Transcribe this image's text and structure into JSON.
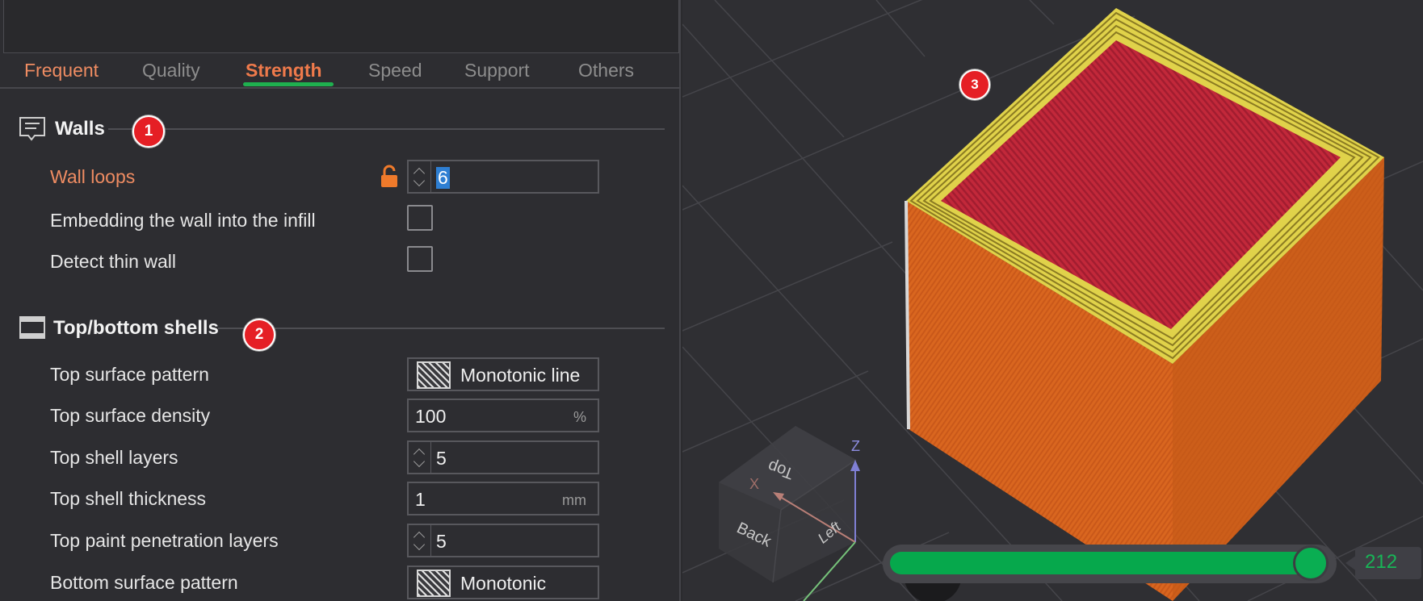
{
  "tabs": [
    {
      "label": "Frequent"
    },
    {
      "label": "Quality"
    },
    {
      "label": "Strength"
    },
    {
      "label": "Speed"
    },
    {
      "label": "Support"
    },
    {
      "label": "Others"
    }
  ],
  "active_tab": "Strength",
  "sections": {
    "walls": {
      "title": "Walls",
      "badge": "1",
      "rows": {
        "wall_loops": {
          "label": "Wall loops",
          "value": "6"
        },
        "embed_wall": {
          "label": "Embedding the wall into the infill",
          "checked": false
        },
        "detect_thin_wall": {
          "label": "Detect thin wall",
          "checked": false
        }
      }
    },
    "shells": {
      "title": "Top/bottom shells",
      "badge": "2",
      "rows": {
        "top_surface_pattern": {
          "label": "Top surface pattern",
          "value": "Monotonic line"
        },
        "top_surface_density": {
          "label": "Top surface density",
          "value": "100",
          "unit": "%"
        },
        "top_shell_layers": {
          "label": "Top shell layers",
          "value": "5"
        },
        "top_shell_thickness": {
          "label": "Top shell thickness",
          "value": "1",
          "unit": "mm"
        },
        "top_paint_penetration": {
          "label": "Top paint penetration layers",
          "value": "5"
        },
        "bottom_surface_pattern": {
          "label": "Bottom surface pattern",
          "value": "Monotonic"
        }
      }
    }
  },
  "viewport": {
    "badge": "3",
    "view_cube": {
      "top": "Top",
      "back": "Back",
      "left": "Left"
    },
    "axes": {
      "x": "X",
      "z": "Z"
    },
    "layer_slider": {
      "value": "212",
      "fraction": 0.98
    }
  },
  "colors": {
    "accent_orange": "#ef7a4b",
    "accent_green": "#06a84c",
    "badge_red": "#e51f25",
    "cube_side": "#d9661f",
    "cube_top": "#c2283a",
    "wall_yellow": "#e3d64a"
  },
  "icons": {
    "walls_section": "walls-icon",
    "shells_section": "shells-icon",
    "lock": "lock-open-icon"
  }
}
